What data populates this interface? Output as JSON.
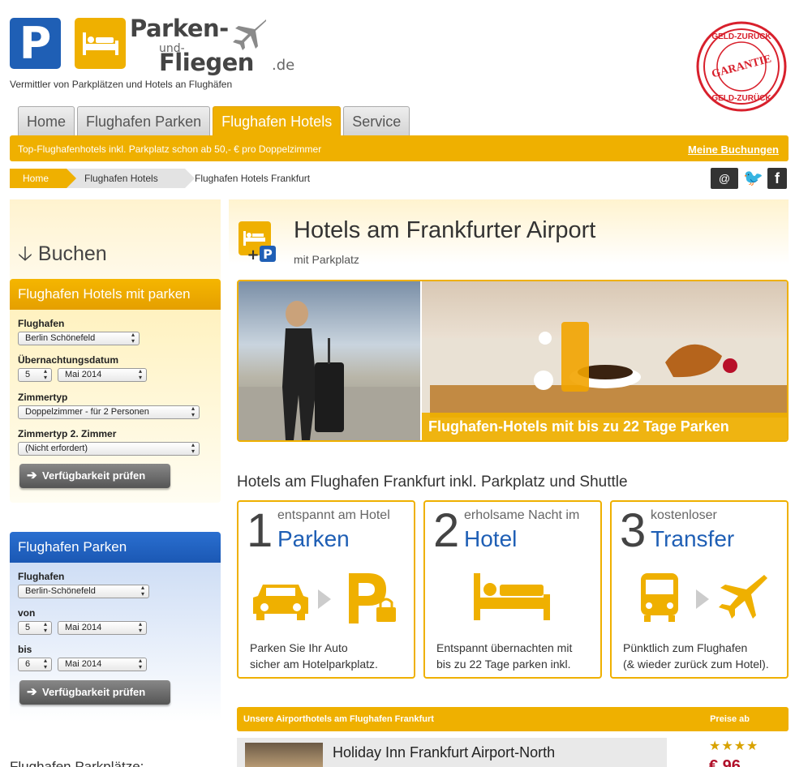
{
  "brand": {
    "logo_p": "P",
    "line1": "Parken-",
    "und": "und-",
    "line2": "Fliegen",
    "tld": ".de",
    "tagline": "Vermittler von Parkplätzen und Hotels an Flughäfen",
    "seal_top": "GELD-ZURÜCK",
    "seal_mid": "GARANTIE",
    "seal_bottom": "GELD-ZURÜCK"
  },
  "nav": {
    "tabs": [
      {
        "label": "Home",
        "active": false
      },
      {
        "label": "Flughafen Parken",
        "active": false
      },
      {
        "label": "Flughafen Hotels",
        "active": true
      },
      {
        "label": "Service",
        "active": false
      }
    ]
  },
  "promo_bar": {
    "text": "Top-Flughafenhotels inkl. Parkplatz schon ab 50,- € pro Doppelzimmer",
    "link": "Meine Buchungen"
  },
  "breadcrumb": [
    "Home",
    "Flughafen Hotels",
    "Flughafen Hotels Frankfurt"
  ],
  "social": {
    "mail": "@",
    "twitter": "🐦",
    "facebook": "f"
  },
  "sidebar": {
    "buchen": "Buchen",
    "hotels_panel": {
      "title": "Flughafen Hotels mit parken",
      "airport_label": "Flughafen",
      "airport_value": "Berlin Schönefeld",
      "date_label": "Übernachtungsdatum",
      "day_value": "5",
      "month_value": "Mai 2014",
      "room_label": "Zimmertyp",
      "room_value": "Doppelzimmer - für 2 Personen",
      "room2_label": "Zimmertyp 2. Zimmer",
      "room2_value": "(Nicht erfordert)",
      "button": "Verfügbarkeit prüfen"
    },
    "parking_panel": {
      "title": "Flughafen Parken",
      "airport_label": "Flughafen",
      "airport_value": "Berlin-Schönefeld",
      "from_label": "von",
      "from_day": "5",
      "from_month": "Mai 2014",
      "to_label": "bis",
      "to_day": "6",
      "to_month": "Mai 2014",
      "button": "Verfügbarkeit prüfen"
    },
    "more_title": "Flughafen Parkplätze:"
  },
  "main": {
    "title": "Hotels am Frankfurter Airport",
    "subtitle": "mit Parkplatz",
    "hero_caption": "Flughafen-Hotels mit bis zu 22 Tage Parken",
    "section_title": "Hotels am Flughafen Frankfurt inkl. Parkplatz und Shuttle",
    "steps": [
      {
        "num": "1",
        "small": "entspannt am Hotel",
        "big": "Parken",
        "text1": "Parken Sie Ihr Auto",
        "text2": "sicher am Hotelparkplatz."
      },
      {
        "num": "2",
        "small": "erholsame Nacht im",
        "big": "Hotel",
        "text1": "Entspannt übernachten mit",
        "text2": "bis zu 22 Tage parken inkl."
      },
      {
        "num": "3",
        "small": "kostenloser",
        "big": "Transfer",
        "text1": "Pünktlich zum Flughafen",
        "text2": "(& wieder zurück zum Hotel)."
      }
    ],
    "table": {
      "title": "Unsere Airporthotels am Flughafen Frankfurt",
      "price_col": "Preise ab",
      "rows": [
        {
          "name": "Holiday Inn Frankfurt Airport-North",
          "stars": "★★★★",
          "price": "€ 96"
        }
      ]
    }
  },
  "colors": {
    "accent": "#efb000",
    "brand_blue": "#1f5fb5",
    "price_red": "#b0102a"
  }
}
